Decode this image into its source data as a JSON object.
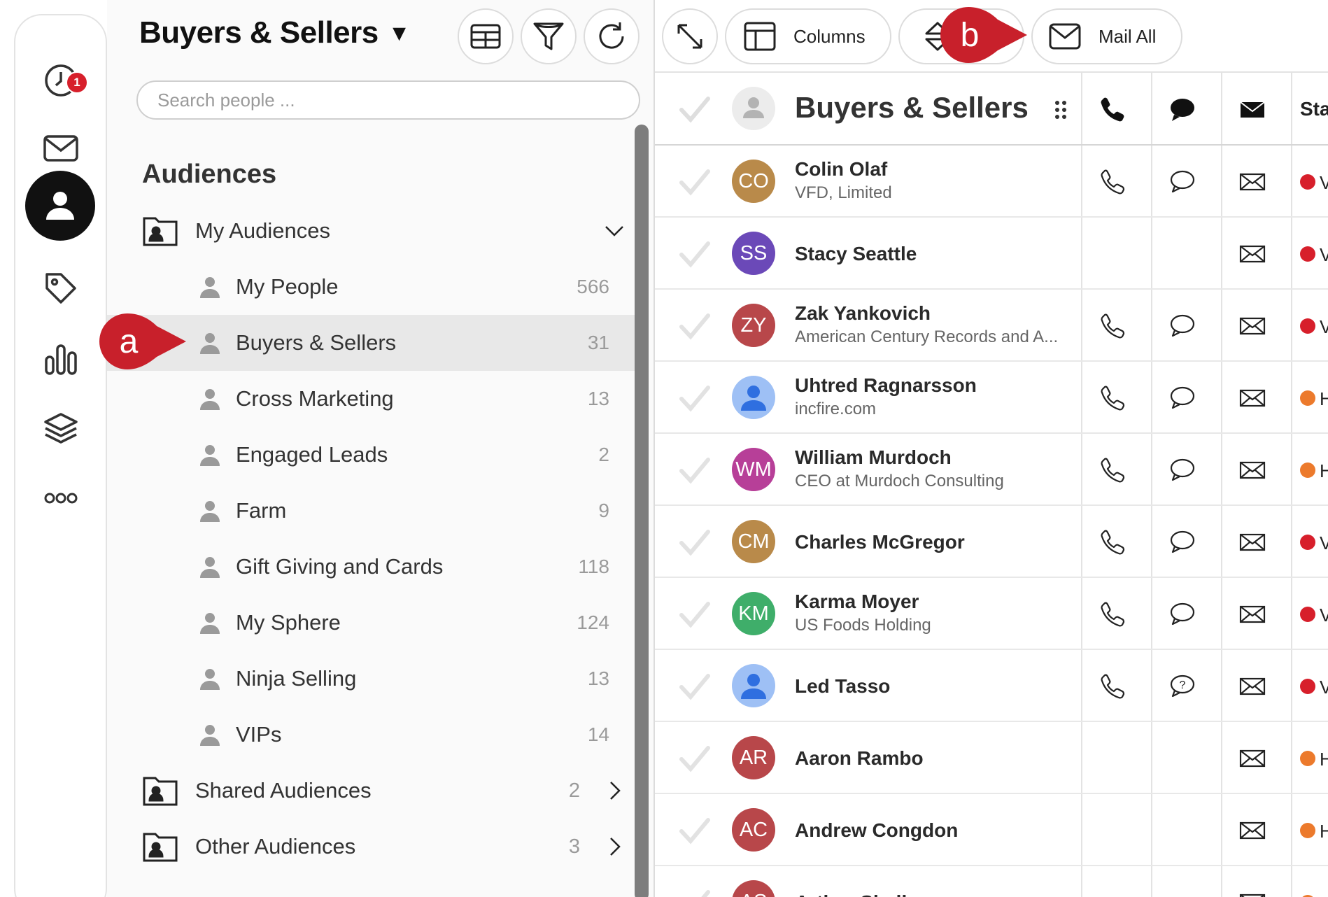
{
  "rail": {
    "notification_count": "1",
    "items": [
      {
        "icon": "clock-icon"
      },
      {
        "icon": "mail-icon"
      },
      {
        "icon": "person-icon"
      },
      {
        "icon": "tag-icon"
      },
      {
        "icon": "bar-chart-icon"
      },
      {
        "icon": "layers-icon"
      },
      {
        "icon": "more-icon"
      }
    ]
  },
  "sidebar": {
    "title": "Buyers & Sellers",
    "title_caret": "▼",
    "search_placeholder": "Search people ...",
    "section_heading": "Audiences",
    "my_audiences": {
      "label": "My Audiences"
    },
    "audiences": [
      {
        "label": "My People",
        "count": "566"
      },
      {
        "label": "Buyers & Sellers",
        "count": "31"
      },
      {
        "label": "Cross Marketing",
        "count": "13"
      },
      {
        "label": "Engaged Leads",
        "count": "2"
      },
      {
        "label": "Farm",
        "count": "9"
      },
      {
        "label": "Gift Giving and Cards",
        "count": "118"
      },
      {
        "label": "My Sphere",
        "count": "124"
      },
      {
        "label": "Ninja Selling",
        "count": "13"
      },
      {
        "label": "VIPs",
        "count": "14"
      }
    ],
    "shared_audiences": {
      "label": "Shared Audiences",
      "count": "2"
    },
    "other_audiences": {
      "label": "Other Audiences",
      "count": "3"
    }
  },
  "toolbar": {
    "columns_label": "Columns",
    "mail_all_label": "Mail All"
  },
  "table": {
    "header_title": "Buyers & Sellers",
    "status_header": "Sta",
    "rows": [
      {
        "initials": "CO",
        "color": "#b98a4a",
        "name": "Colin Olaf",
        "sub": "VFD, Limited",
        "phone": true,
        "chat": "normal",
        "status_color": "#d71f2b",
        "status": "V"
      },
      {
        "initials": "SS",
        "color": "#6b49b8",
        "name": "Stacy Seattle",
        "sub": "",
        "phone": false,
        "chat": "none",
        "status_color": "#d71f2b",
        "status": "V"
      },
      {
        "initials": "ZY",
        "color": "#b8474a",
        "name": "Zak Yankovich",
        "sub": "American Century Records and A...",
        "phone": true,
        "chat": "normal",
        "status_color": "#d71f2b",
        "status": "V"
      },
      {
        "initials": "",
        "color": "#9ec0f5",
        "name": "Uhtred Ragnarsson",
        "sub": "incfire.com",
        "phone": true,
        "chat": "normal",
        "status_color": "#ec7a2c",
        "status": "H"
      },
      {
        "initials": "WM",
        "color": "#b73f98",
        "name": "William Murdoch",
        "sub": "CEO at Murdoch Consulting",
        "phone": true,
        "chat": "normal",
        "status_color": "#ec7a2c",
        "status": "H"
      },
      {
        "initials": "CM",
        "color": "#b98a4a",
        "name": "Charles McGregor",
        "sub": "",
        "phone": true,
        "chat": "normal",
        "status_color": "#d71f2b",
        "status": "V"
      },
      {
        "initials": "KM",
        "color": "#3fae6a",
        "name": "Karma Moyer",
        "sub": "US Foods Holding",
        "phone": true,
        "chat": "normal",
        "status_color": "#d71f2b",
        "status": "V"
      },
      {
        "initials": "",
        "color": "#9ec0f5",
        "name": "Led Tasso",
        "sub": "",
        "phone": true,
        "chat": "question",
        "status_color": "#d71f2b",
        "status": "V"
      },
      {
        "initials": "AR",
        "color": "#b8474a",
        "name": "Aaron Rambo",
        "sub": "",
        "phone": false,
        "chat": "none",
        "status_color": "#ec7a2c",
        "status": "H"
      },
      {
        "initials": "AC",
        "color": "#b8474a",
        "name": "Andrew Congdon",
        "sub": "",
        "phone": false,
        "chat": "none",
        "status_color": "#ec7a2c",
        "status": "H"
      },
      {
        "initials": "AS",
        "color": "#b8474a",
        "name": "Arthur Shelby",
        "sub": "",
        "phone": false,
        "chat": "none",
        "status_color": "#ec7a2c",
        "status": "H"
      }
    ]
  },
  "callouts": {
    "a": "a",
    "b": "b"
  },
  "colors": {
    "accent_red": "#d71f2b",
    "callout_red": "#c8202b"
  }
}
